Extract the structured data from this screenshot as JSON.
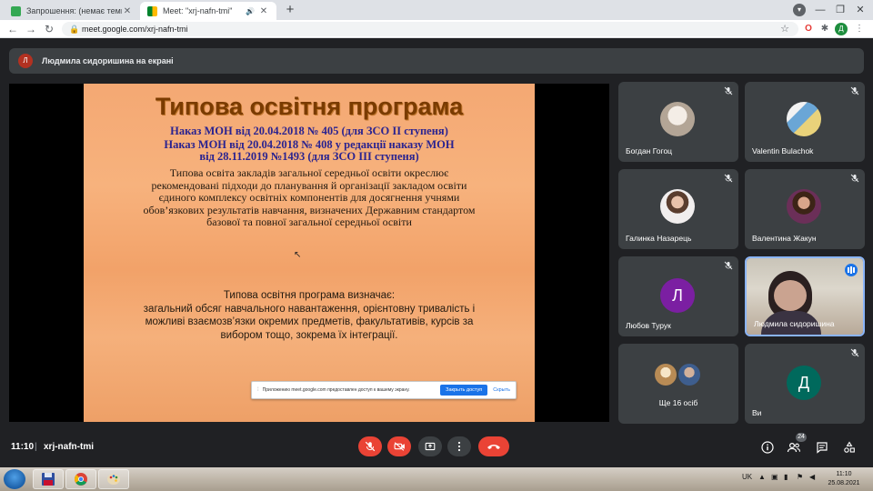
{
  "browser": {
    "tabs": [
      {
        "title": "Запрошення: (немає теми) @ ср",
        "active": false
      },
      {
        "title": "Meet: \"xrj-nafn-tmi\"",
        "active": true
      }
    ],
    "url": "meet.google.com/xrj-nafn-tmi",
    "profile_initial": "Д"
  },
  "meet": {
    "presenter_banner": {
      "initial": "Л",
      "text": "Людмила сидоришина на екрані"
    },
    "slide": {
      "title": "Типова освітня програма",
      "order_line1": "Наказ МОН від 20.04.2018 № 405 (для ЗСО ІІ ступеня)",
      "order_line2a": "Наказ МОН від 20.04.2018 № 408 у редакції наказу МОН",
      "order_line2b": "від 28.11.2019 №1493  (для ЗСО ІІІ ступеня)",
      "paragraph1": "Типова освіта закладів загальної середньої освіти окреслює рекомендовані підходи до планування й організації закладом освіти єдиного комплексу освітніх компонентів для досягнення учнями обов’язкових результатів навчання, визначених Державним стандартом базової та повної загальної середньої освіти",
      "paragraph2_heading": "Типова освітня програма визначає:",
      "paragraph2": "загальний обсяг навчального навантаження, орієнтовну тривалість і можливі взаємозв’язки окремих предметів, факультативів, курсів за вибором тощо, зокрема їх інтеграції."
    },
    "share_bar": {
      "message": "Приложению meet.google.com предоставлен доступ к вашему экрану.",
      "stop_label": "Закрыть доступ",
      "hide_label": "Скрыть"
    },
    "participants": [
      {
        "name": "Богдан Гогоц",
        "type": "photo",
        "muted": true
      },
      {
        "name": "Valentin Bulachok",
        "type": "photo",
        "muted": true
      },
      {
        "name": "Галинка Назарець",
        "type": "photo",
        "muted": true
      },
      {
        "name": "Валентина Жакун",
        "type": "photo",
        "muted": true
      },
      {
        "name": "Любов Турук",
        "type": "letter",
        "letter": "Л",
        "color": "#7b1fa2",
        "muted": true
      },
      {
        "name": "Людмила сидоришина",
        "type": "video",
        "speaking": true
      },
      {
        "name": "Ще 16 осіб",
        "type": "group"
      },
      {
        "name": "Ви",
        "type": "letter",
        "letter": "Д",
        "color": "#00695c",
        "muted": true
      }
    ],
    "bottom": {
      "time": "11:10",
      "separator": "|",
      "meeting_code": "xrj-nafn-tmi",
      "people_count": "24"
    }
  },
  "taskbar": {
    "lang": "UK",
    "time": "11:10",
    "date": "25.08.2021"
  },
  "colors": {
    "end_call": "#ea4335",
    "slide_title": "#7a3b00",
    "slide_order_text": "#2a2390",
    "accent": "#1a73e8"
  }
}
